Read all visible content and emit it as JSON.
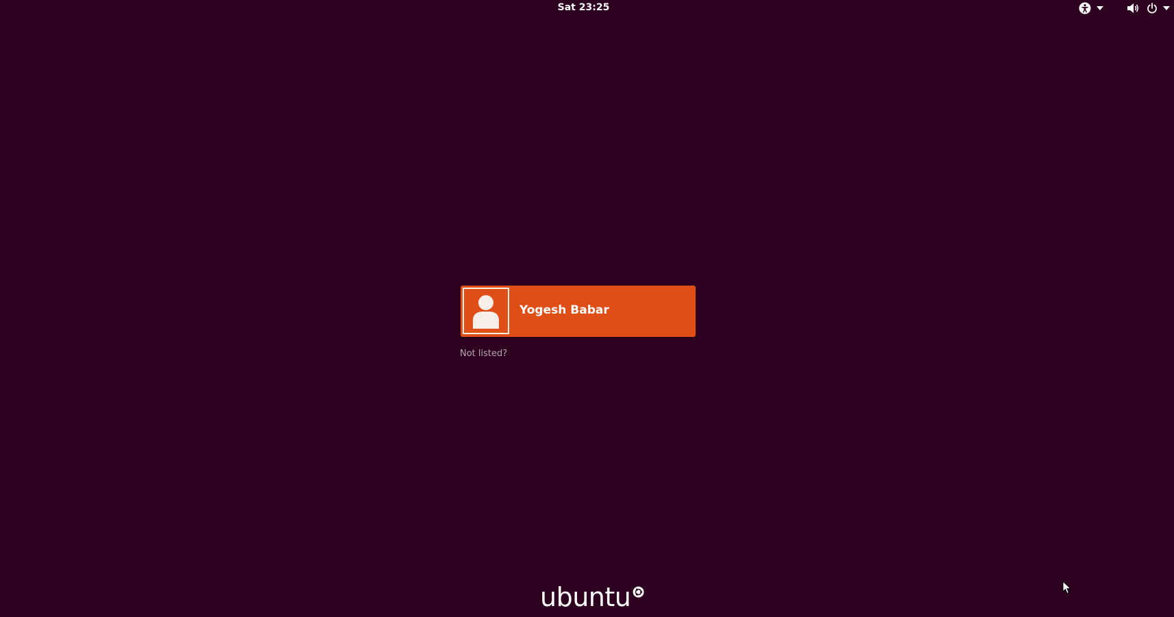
{
  "topbar": {
    "clock": "Sat 23:25",
    "icons": {
      "accessibility": "accessibility-icon",
      "sound": "volume-icon",
      "power": "power-icon",
      "dropdown": "chevron-down-icon"
    }
  },
  "login": {
    "users": [
      {
        "name": "Yogesh Babar",
        "avatar": "user-avatar-icon"
      }
    ],
    "not_listed": "Not listed?"
  },
  "branding": {
    "wordmark": "ubuntu",
    "logo": "circle-of-friends-icon"
  },
  "colors": {
    "background": "#2c001e",
    "user_card": "#e04e17",
    "text": "#ffffff",
    "muted_text": "#b9a7b3"
  }
}
